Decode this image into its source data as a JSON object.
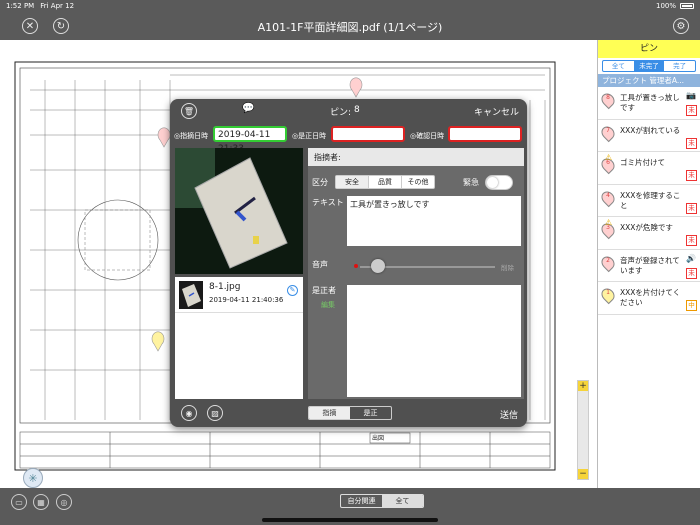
{
  "status_bar": {
    "time": "1:52 PM",
    "date": "Fri Apr 12",
    "battery": "100%"
  },
  "header": {
    "title": "A101-1F平面詳細図.pdf (1/1ページ)"
  },
  "pin_panel": {
    "title": "ピン",
    "filters": [
      "全て",
      "未完了",
      "完了"
    ],
    "selected_filter": "未完了",
    "project_label": "プロジェクト 管理者A...",
    "items": [
      {
        "num": "8",
        "text": "工具が置きっ放しです",
        "status": "未",
        "marker_color": "#ffd0d0",
        "extra_icon": "camera-icon",
        "warn": false
      },
      {
        "num": "7",
        "text": "XXXが割れている",
        "status": "未",
        "marker_color": "#ffd0d0",
        "extra_icon": "",
        "warn": false
      },
      {
        "num": "6",
        "text": "ゴミ片付けて",
        "status": "未",
        "marker_color": "#ffd0d0",
        "extra_icon": "",
        "warn": true
      },
      {
        "num": "4",
        "text": "XXXを修理すること",
        "status": "未",
        "marker_color": "#ffd0d0",
        "extra_icon": "",
        "warn": false
      },
      {
        "num": "3",
        "text": "XXXが危険です",
        "status": "未",
        "marker_color": "#ffd0d0",
        "extra_icon": "",
        "warn": true
      },
      {
        "num": "2",
        "text": "音声が登録されています",
        "status": "未",
        "marker_color": "#ffd0d0",
        "extra_icon": "speaker-icon",
        "warn": false
      },
      {
        "num": "1",
        "text": "XXXを片付けてください",
        "status": "中",
        "marker_color": "#fff3a0",
        "extra_icon": "",
        "warn": false
      }
    ]
  },
  "dialog": {
    "pin_label": "ピン:",
    "pin_number": "8",
    "cancel": "キャンセル",
    "date_labels": {
      "reported": "◎指摘日時",
      "corrected": "◎是正日時",
      "confirmed": "◎確認日時"
    },
    "reported_date": "2019-04-11 21:33",
    "corrected_date": "",
    "confirmed_date": "",
    "reporter_label": "指摘者:",
    "category_label": "区分",
    "categories": [
      "安全",
      "品質",
      "その他"
    ],
    "selected_category": "安全",
    "urgent_label": "緊急",
    "text_label": "テキスト",
    "text_value": "工具が置きっ放しです",
    "audio_label": "音声",
    "delete_label": "削除",
    "corrector_label": "是正者",
    "edit_label": "編集",
    "file_name": "8-1.jpg",
    "file_date": "2019-04-11 21:40:36",
    "footer_tabs": [
      "指摘",
      "是正"
    ],
    "selected_footer_tab": "指摘",
    "send": "送信"
  },
  "bottom_bar": {
    "tabs": [
      "自分関連",
      "全て"
    ],
    "selected": "全て"
  },
  "zoom": {
    "plus": "+",
    "minus": "−"
  },
  "drawing_text": {
    "exit_label": "出図"
  }
}
